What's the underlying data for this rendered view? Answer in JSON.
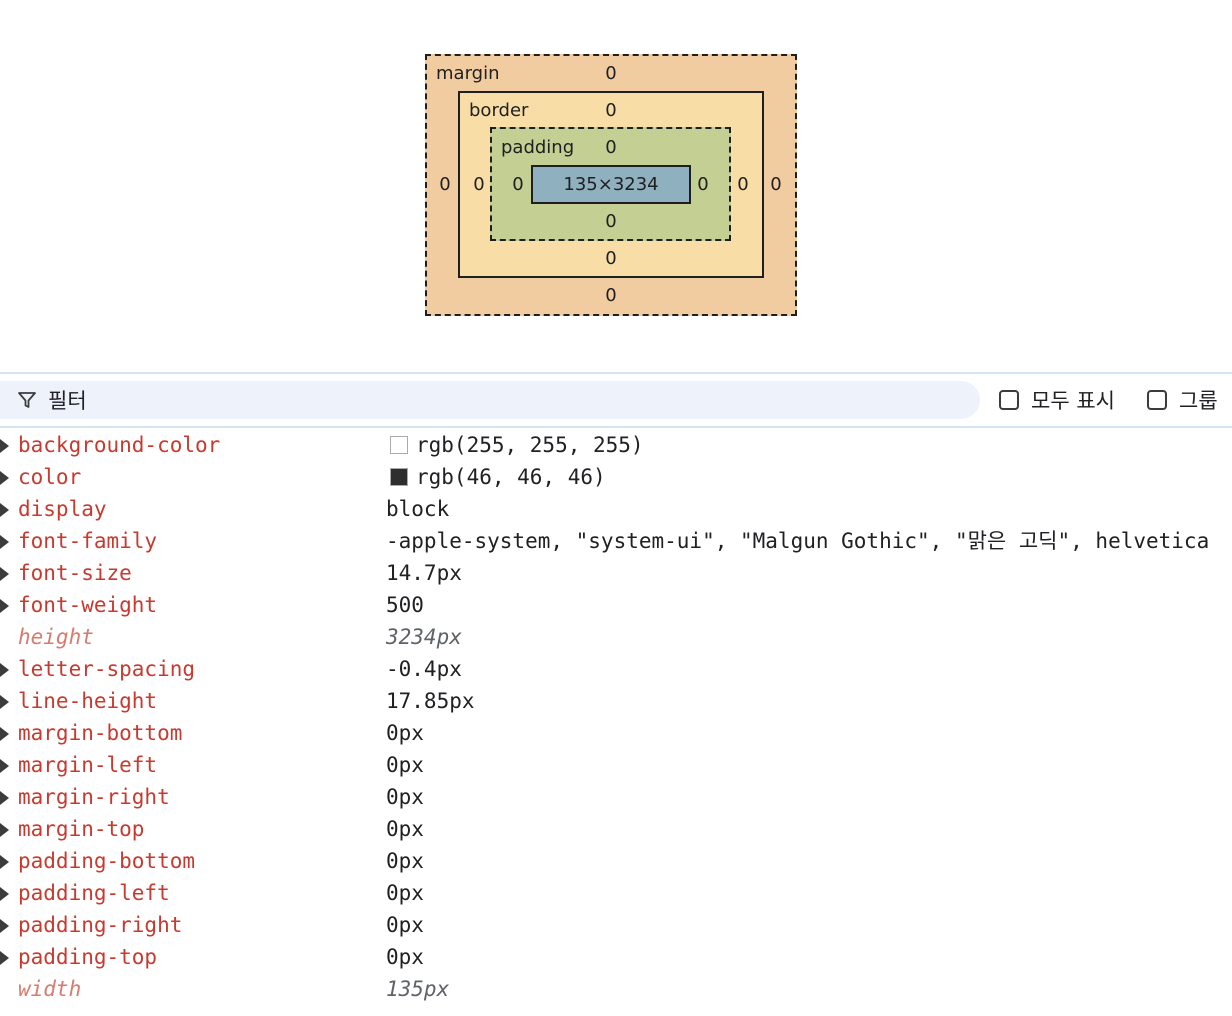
{
  "box_model": {
    "margin_label": "margin",
    "border_label": "border",
    "padding_label": "padding",
    "content_size": "135×3234",
    "margin": {
      "top": "0",
      "right": "0",
      "bottom": "0",
      "left": "0"
    },
    "border": {
      "top": "0",
      "right": "0",
      "bottom": "0",
      "left": "0"
    },
    "padding": {
      "top": "0",
      "right": "0",
      "bottom": "0",
      "left": "0"
    },
    "colors": {
      "margin": "#f1cca0",
      "border": "#f8dea6",
      "padding": "#c3cf93",
      "content": "#8fb0bf"
    }
  },
  "filter": {
    "placeholder": "필터",
    "show_all_label": "모두 표시",
    "group_label": "그룹"
  },
  "properties": [
    {
      "name": "background-color",
      "value": "rgb(255, 255, 255)",
      "swatch": "#ffffff",
      "inherited": false
    },
    {
      "name": "color",
      "value": "rgb(46, 46, 46)",
      "swatch": "#2e2e2e",
      "inherited": false
    },
    {
      "name": "display",
      "value": "block",
      "inherited": false
    },
    {
      "name": "font-family",
      "value": "-apple-system, \"system-ui\", \"Malgun Gothic\", \"맑은 고딕\", helvetica",
      "inherited": false
    },
    {
      "name": "font-size",
      "value": "14.7px",
      "inherited": false
    },
    {
      "name": "font-weight",
      "value": "500",
      "inherited": false
    },
    {
      "name": "height",
      "value": "3234px",
      "inherited": true
    },
    {
      "name": "letter-spacing",
      "value": "-0.4px",
      "inherited": false
    },
    {
      "name": "line-height",
      "value": "17.85px",
      "inherited": false
    },
    {
      "name": "margin-bottom",
      "value": "0px",
      "inherited": false
    },
    {
      "name": "margin-left",
      "value": "0px",
      "inherited": false
    },
    {
      "name": "margin-right",
      "value": "0px",
      "inherited": false
    },
    {
      "name": "margin-top",
      "value": "0px",
      "inherited": false
    },
    {
      "name": "padding-bottom",
      "value": "0px",
      "inherited": false
    },
    {
      "name": "padding-left",
      "value": "0px",
      "inherited": false
    },
    {
      "name": "padding-right",
      "value": "0px",
      "inherited": false
    },
    {
      "name": "padding-top",
      "value": "0px",
      "inherited": false
    },
    {
      "name": "width",
      "value": "135px",
      "inherited": true
    }
  ]
}
